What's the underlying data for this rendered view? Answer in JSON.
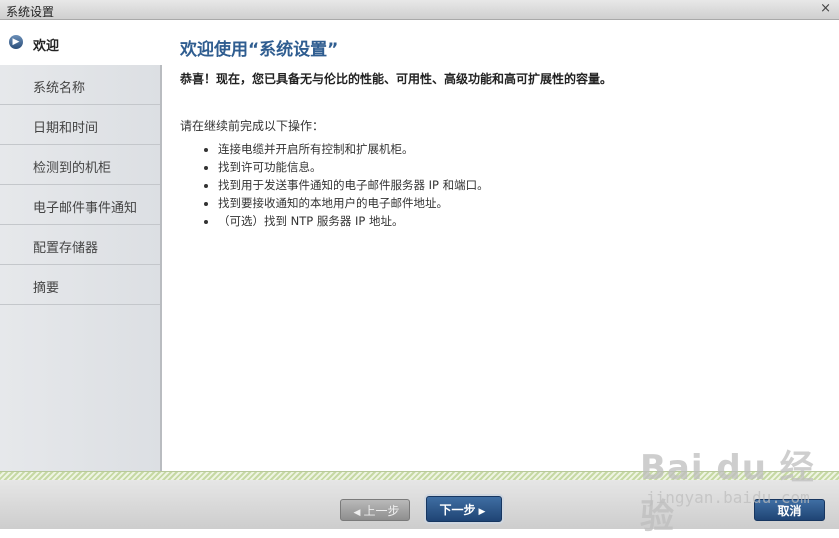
{
  "window": {
    "title": "系统设置",
    "close_glyph": "×"
  },
  "sidebar": {
    "active": {
      "label": "欢迎",
      "icon": "arrow-right-circle-icon"
    },
    "items": [
      {
        "label": "系统名称"
      },
      {
        "label": "日期和时间"
      },
      {
        "label": "检测到的机柜"
      },
      {
        "label": "电子邮件事件通知"
      },
      {
        "label": "配置存储器"
      },
      {
        "label": "摘要"
      }
    ]
  },
  "main": {
    "heading": "欢迎使用“系统设置”",
    "congrats": "恭喜！现在，您已具备无与伦比的性能、可用性、高级功能和高可扩展性的容量。",
    "intro": "请在继续前完成以下操作：",
    "steps": [
      "连接电缆并开启所有控制和扩展机柜。",
      "找到许可功能信息。",
      "找到用于发送事件通知的电子邮件服务器 IP 和端口。",
      "找到要接收通知的本地用户的电子邮件地址。",
      "（可选）找到 NTP 服务器 IP 地址。"
    ]
  },
  "footer": {
    "prev_label": "上一步",
    "next_label": "下一步",
    "cancel_label": "取消"
  },
  "watermark": {
    "logo": "Bai du 经验",
    "url": "jingyan.baidu.com"
  }
}
